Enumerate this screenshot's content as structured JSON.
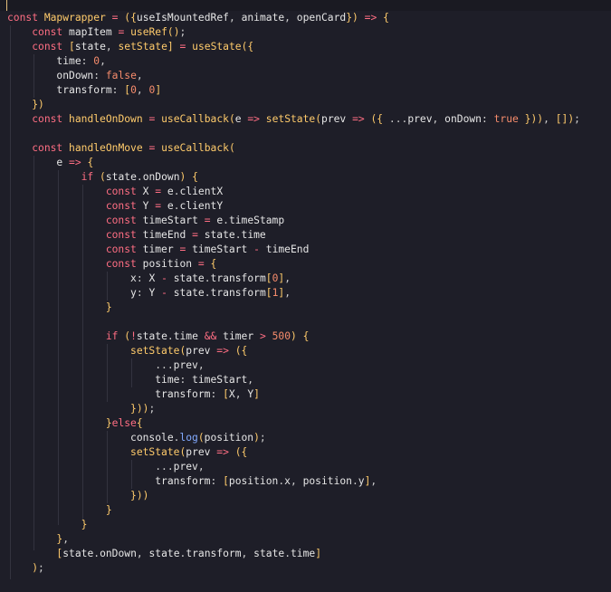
{
  "editor": {
    "language": "javascript",
    "theme_colors": {
      "background": "#1e1e28",
      "keyword": "#ff6e83",
      "function": "#ffcb6b",
      "number": "#f78c6c",
      "text": "#e6e6e6",
      "method": "#82aaff"
    },
    "lines": [
      "const Mapwrapper = ({useIsMountedRef, animate, openCard}) => {",
      "    const mapItem = useRef();",
      "    const [state, setState] = useState({",
      "        time: 0,",
      "        onDown: false,",
      "        transform: [0, 0]",
      "    })",
      "    const handleOnDown = useCallback(e => setState(prev => ({ ...prev, onDown: true })), []);",
      "",
      "    const handleOnMove = useCallback(",
      "        e => {",
      "            if (state.onDown) {",
      "                const X = e.clientX",
      "                const Y = e.clientY",
      "                const timeStart = e.timeStamp",
      "                const timeEnd = state.time",
      "                const timer = timeStart - timeEnd",
      "                const position = {",
      "                    x: X - state.transform[0],",
      "                    y: Y - state.transform[1],",
      "                }",
      "",
      "                if (!state.time && timer > 500) {",
      "                    setState(prev => ({",
      "                        ...prev,",
      "                        time: timeStart,",
      "                        transform: [X, Y]",
      "                    }));",
      "                }else{",
      "                    console.log(position);",
      "                    setState(prev => ({",
      "                        ...prev,",
      "                        transform: [position.x, position.y],",
      "                    }))",
      "                }",
      "            }",
      "        },",
      "        [state.onDown, state.transform, state.time]",
      "    );"
    ]
  }
}
